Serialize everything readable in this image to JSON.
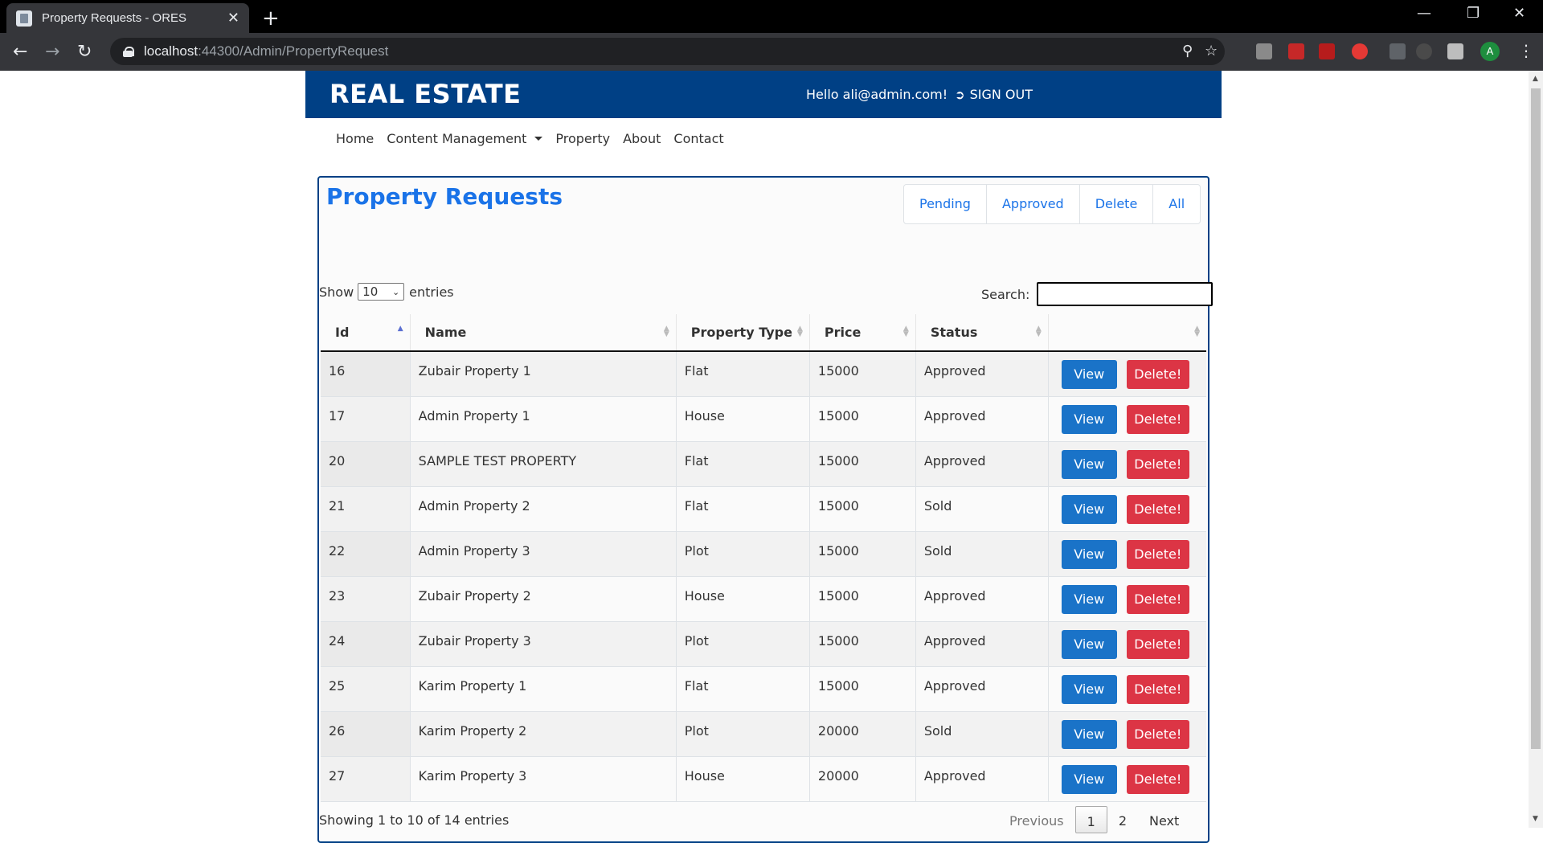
{
  "browser": {
    "tab_title": "Property Requests - ORES",
    "tab_close": "✕",
    "new_tab": "+",
    "url_host": "localhost",
    "url_rest": ":44300/Admin/PropertyRequest",
    "avatar_letter": "A",
    "icons": [
      "back-icon",
      "forward-icon",
      "reload-icon",
      "lock-icon",
      "zoom-icon",
      "star-icon",
      "extensions-icon",
      "menu-icon"
    ]
  },
  "header": {
    "brand": "REAL ESTATE",
    "greeting": "Hello ali@admin.com!",
    "signout": "SIGN OUT",
    "bg_color": "#004085"
  },
  "nav": {
    "home": "Home",
    "content_management": "Content Management",
    "property": "Property",
    "about": "About",
    "contact": "Contact"
  },
  "page": {
    "title": "Property Requests",
    "filters": {
      "pending": "Pending",
      "approved": "Approved",
      "delete": "Delete",
      "all": "All"
    },
    "show_label": "Show",
    "entries_value": "10",
    "entries_label": "entries",
    "search_label": "Search:",
    "columns": {
      "id": "Id",
      "name": "Name",
      "type": "Property Type",
      "price": "Price",
      "status": "Status"
    },
    "view_label": "View",
    "delete_label": "Delete!",
    "rows": [
      {
        "id": "16",
        "name": "Zubair Property 1",
        "type": "Flat",
        "price": "15000",
        "status": "Approved"
      },
      {
        "id": "17",
        "name": "Admin Property 1",
        "type": "House",
        "price": "15000",
        "status": "Approved"
      },
      {
        "id": "20",
        "name": "SAMPLE TEST PROPERTY",
        "type": "Flat",
        "price": "15000",
        "status": "Approved"
      },
      {
        "id": "21",
        "name": "Admin Property 2",
        "type": "Flat",
        "price": "15000",
        "status": "Sold"
      },
      {
        "id": "22",
        "name": "Admin Property 3",
        "type": "Plot",
        "price": "15000",
        "status": "Sold"
      },
      {
        "id": "23",
        "name": "Zubair Property 2",
        "type": "House",
        "price": "15000",
        "status": "Approved"
      },
      {
        "id": "24",
        "name": "Zubair Property 3",
        "type": "Plot",
        "price": "15000",
        "status": "Approved"
      },
      {
        "id": "25",
        "name": "Karim Property 1",
        "type": "Flat",
        "price": "15000",
        "status": "Approved"
      },
      {
        "id": "26",
        "name": "Karim Property 2",
        "type": "Plot",
        "price": "20000",
        "status": "Sold"
      },
      {
        "id": "27",
        "name": "Karim Property 3",
        "type": "House",
        "price": "20000",
        "status": "Approved"
      }
    ],
    "info": "Showing 1 to 10 of 14 entries",
    "pagination": {
      "previous": "Previous",
      "page1": "1",
      "page2": "2",
      "next": "Next"
    },
    "colors": {
      "accent": "#1a73e8",
      "view": "#1a73c8",
      "delete": "#dc3545"
    }
  }
}
